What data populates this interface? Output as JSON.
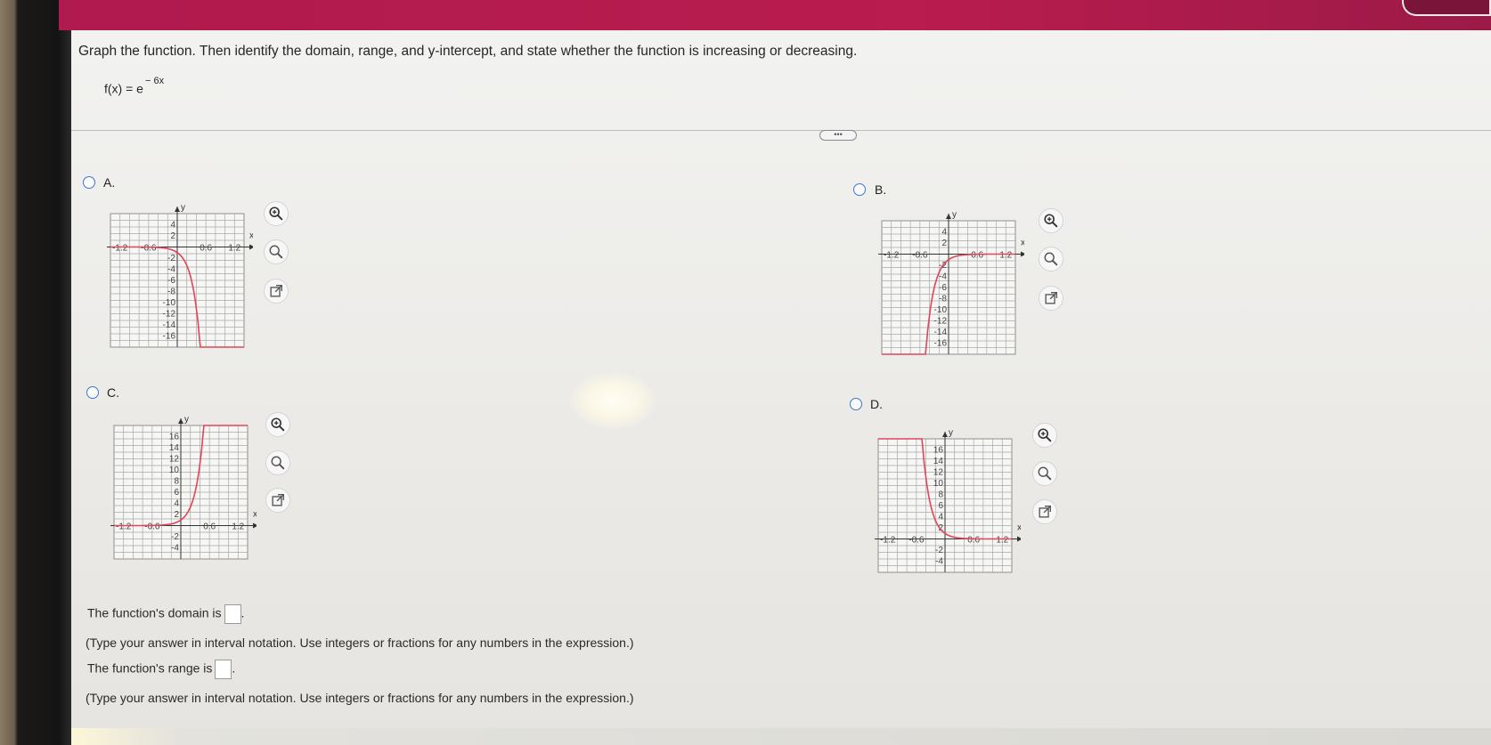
{
  "question": "Graph the function. Then identify the domain, range, and y-intercept, and state whether the function is increasing or decreasing.",
  "function": {
    "base": "f(x) = e",
    "exponent": "− 6x"
  },
  "more_button": "•••",
  "options": [
    {
      "letter": "A.",
      "x_ticks": [
        "-1.2",
        "-0.6",
        "0.6",
        "1.2"
      ],
      "y_ticks": [
        "4",
        "2",
        "-2",
        "-4",
        "-6",
        "-8",
        "-10",
        "-12",
        "-14",
        "-16"
      ]
    },
    {
      "letter": "B.",
      "x_ticks": [
        "-1.2",
        "-0.6",
        "0.6",
        "1.2"
      ],
      "y_ticks": [
        "4",
        "2",
        "-2",
        "-4",
        "-6",
        "-8",
        "-10",
        "-12",
        "-14",
        "-16"
      ]
    },
    {
      "letter": "C.",
      "x_ticks": [
        "-1.2",
        "-0.6",
        "0.6",
        "1.2"
      ],
      "y_ticks": [
        "16",
        "14",
        "12",
        "10",
        "8",
        "6",
        "4",
        "2",
        "-2",
        "-4"
      ]
    },
    {
      "letter": "D.",
      "x_ticks": [
        "-1.2",
        "-0.6",
        "0.6",
        "1.2"
      ],
      "y_ticks": [
        "16",
        "14",
        "12",
        "10",
        "8",
        "6",
        "4",
        "2",
        "-2",
        "-4"
      ]
    }
  ],
  "axis_labels": {
    "x": "x",
    "y": "y"
  },
  "icons": {
    "zoom_in": "zoom-in-icon",
    "zoom_out": "zoom-out-icon",
    "popout": "external-link-icon"
  },
  "answers": {
    "domain_label": "The function's domain is",
    "range_label": "The function's range is",
    "hint": "(Type your answer in interval notation. Use integers or fractions for any numbers in the expression.)"
  },
  "colors": {
    "curve": "#e0455a",
    "grid": "#9c9c9c",
    "radio": "#3b78c8",
    "topbar": "#b91c4f"
  }
}
